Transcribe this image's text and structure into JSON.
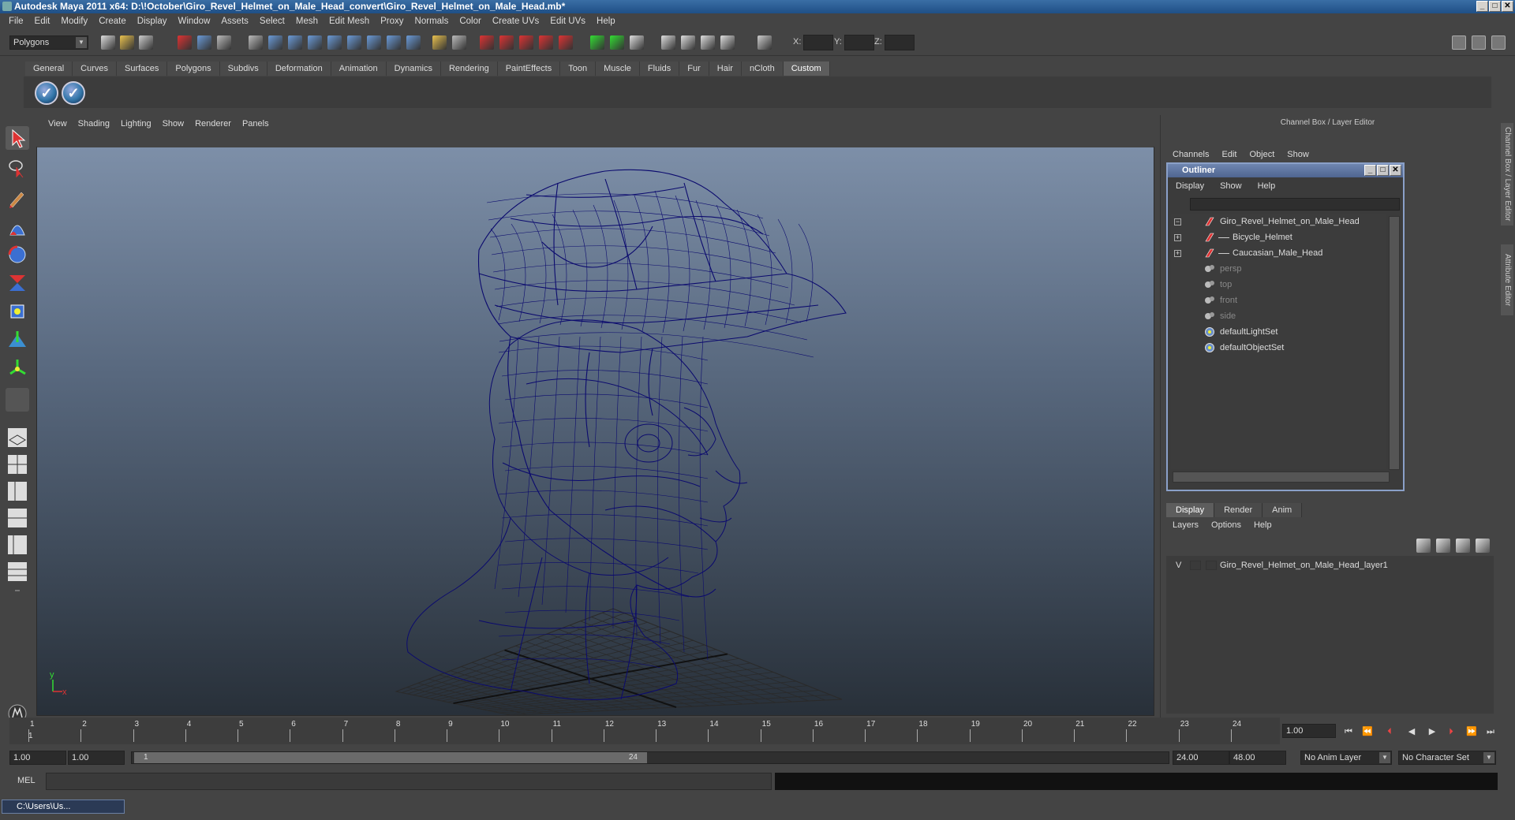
{
  "window": {
    "title": "Autodesk Maya 2011 x64: D:\\!October\\Giro_Revel_Helmet_on_Male_Head_convert\\Giro_Revel_Helmet_on_Male_Head.mb*"
  },
  "menu": [
    "File",
    "Edit",
    "Modify",
    "Create",
    "Display",
    "Window",
    "Assets",
    "Select",
    "Mesh",
    "Edit Mesh",
    "Proxy",
    "Normals",
    "Color",
    "Create UVs",
    "Edit UVs",
    "Help"
  ],
  "status": {
    "mode": "Polygons",
    "x_label": "X:",
    "y_label": "Y:",
    "z_label": "Z:"
  },
  "shelf_tabs": [
    "General",
    "Curves",
    "Surfaces",
    "Polygons",
    "Subdivs",
    "Deformation",
    "Animation",
    "Dynamics",
    "Rendering",
    "PaintEffects",
    "Toon",
    "Muscle",
    "Fluids",
    "Fur",
    "Hair",
    "nCloth",
    "Custom"
  ],
  "shelf_active": "Custom",
  "viewport": {
    "menu": [
      "View",
      "Shading",
      "Lighting",
      "Show",
      "Renderer",
      "Panels"
    ],
    "axis_x": "x",
    "axis_y": "y"
  },
  "right_panel": {
    "header": "Channel Box / Layer Editor",
    "menu": [
      "Channels",
      "Edit",
      "Object",
      "Show"
    ],
    "side_tabs": [
      "Channel Box / Layer Editor",
      "Attribute Editor"
    ]
  },
  "outliner": {
    "title": "Outliner",
    "menu": [
      "Display",
      "Show",
      "Help"
    ],
    "items": [
      {
        "label": "Giro_Revel_Helmet_on_Male_Head",
        "expander": "−",
        "dim": false
      },
      {
        "label": "Bicycle_Helmet",
        "expander": "+",
        "dim": false
      },
      {
        "label": "Caucasian_Male_Head",
        "expander": "+",
        "dim": false
      },
      {
        "label": "persp",
        "expander": "",
        "dim": true
      },
      {
        "label": "top",
        "expander": "",
        "dim": true
      },
      {
        "label": "front",
        "expander": "",
        "dim": true
      },
      {
        "label": "side",
        "expander": "",
        "dim": true
      },
      {
        "label": "defaultLightSet",
        "expander": "",
        "dim": false
      },
      {
        "label": "defaultObjectSet",
        "expander": "",
        "dim": false
      }
    ]
  },
  "layers": {
    "tabs": [
      "Display",
      "Render",
      "Anim"
    ],
    "menu": [
      "Layers",
      "Options",
      "Help"
    ],
    "rows": [
      {
        "visible": "V",
        "name": "Giro_Revel_Helmet_on_Male_Head_layer1"
      }
    ]
  },
  "timeline": {
    "ticks": [
      "1",
      "2",
      "3",
      "4",
      "5",
      "6",
      "7",
      "8",
      "9",
      "10",
      "11",
      "12",
      "13",
      "14",
      "15",
      "16",
      "17",
      "18",
      "19",
      "20",
      "21",
      "22",
      "23",
      "24"
    ],
    "current_frame": "1.00",
    "start_marker": "1"
  },
  "range": {
    "start": "1.00",
    "start2": "1.00",
    "thumb_start": "1",
    "thumb_end": "24",
    "end": "24.00",
    "end2": "48.00",
    "anim_layer": "No Anim Layer",
    "character_set": "No Character Set"
  },
  "mel": {
    "label": "MEL"
  },
  "taskbar": {
    "item": "C:\\Users\\Us..."
  },
  "colors": {
    "wire": "#0b0a6e",
    "accent": "#5d5d5d"
  }
}
